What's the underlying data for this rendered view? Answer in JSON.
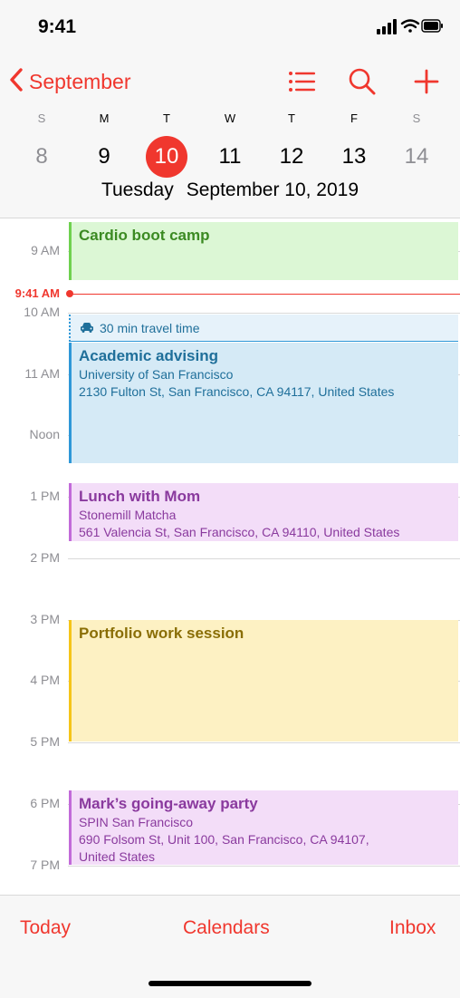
{
  "status": {
    "time": "9:41"
  },
  "nav": {
    "back_label": "September",
    "colors": {
      "accent": "#f0372e"
    },
    "icons": [
      "list-icon",
      "search-icon",
      "plus-icon"
    ]
  },
  "week": {
    "days": [
      {
        "letter": "S",
        "num": "8"
      },
      {
        "letter": "M",
        "num": "9"
      },
      {
        "letter": "T",
        "num": "10"
      },
      {
        "letter": "W",
        "num": "11"
      },
      {
        "letter": "T",
        "num": "12"
      },
      {
        "letter": "F",
        "num": "13"
      },
      {
        "letter": "S",
        "num": "14"
      }
    ],
    "selected_weekday": "Tuesday",
    "selected_date": "September 10, 2019"
  },
  "timeline": {
    "hours": [
      "9 AM",
      "10 AM",
      "11 AM",
      "Noon",
      "1 PM",
      "2 PM",
      "3 PM",
      "4 PM",
      "5 PM",
      "6 PM",
      "7 PM"
    ],
    "now_label": "9:41 AM",
    "travel_time": "30 min travel time",
    "events": [
      {
        "title": "Cardio boot camp",
        "lines": []
      },
      {
        "title": "Academic advising",
        "lines": [
          "University of San Francisco",
          "2130 Fulton St, San Francisco, CA  94117, United States"
        ]
      },
      {
        "title": "Lunch with Mom",
        "lines": [
          "Stonemill Matcha",
          "561 Valencia St, San Francisco, CA  94110, United States"
        ]
      },
      {
        "title": "Portfolio work session",
        "lines": []
      },
      {
        "title": "Mark’s going-away party",
        "lines": [
          "SPIN San Francisco",
          "690 Folsom St, Unit 100, San Francisco, CA  94107,",
          "United States"
        ]
      }
    ]
  },
  "tabbar": {
    "today": "Today",
    "calendars": "Calendars",
    "inbox": "Inbox"
  }
}
